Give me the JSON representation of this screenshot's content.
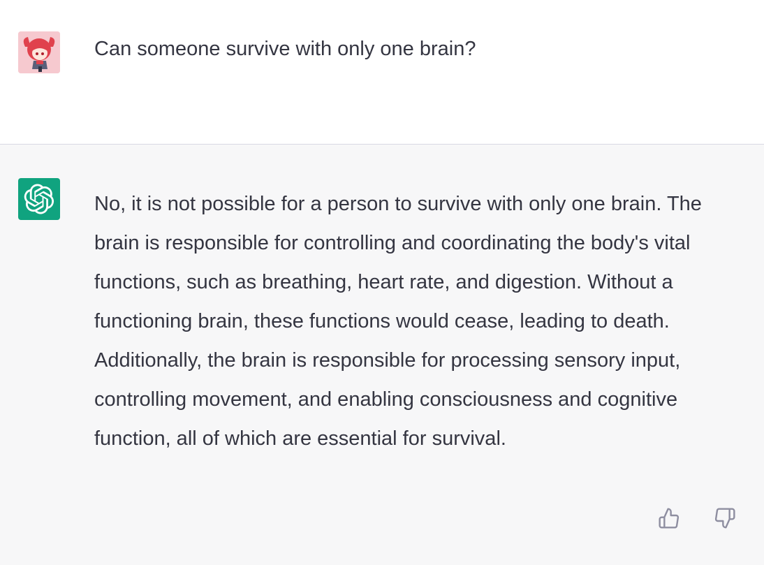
{
  "conversation": {
    "user_message": {
      "text": "Can someone survive with only one brain?",
      "avatar": "user-avatar-anime"
    },
    "assistant_message": {
      "avatar": "openai-logo-icon",
      "text": "No, it is not possible for a person to survive with only one brain. The brain is responsible for controlling and coordinating the body's vital functions, such as breathing, heart rate, and digestion. Without a functioning brain, these functions would cease, leading to death. Additionally, the brain is responsible for processing sensory input, controlling movement, and enabling consciousness and cognitive function, all of which are essential for survival."
    },
    "feedback": {
      "thumbs_up_icon": "thumbs-up-icon",
      "thumbs_down_icon": "thumbs-down-icon"
    }
  },
  "colors": {
    "assistant_bg": "#f7f7f8",
    "user_bg": "#ffffff",
    "text": "#343541",
    "brand": "#10a37f",
    "icon": "#8e8ea0"
  }
}
